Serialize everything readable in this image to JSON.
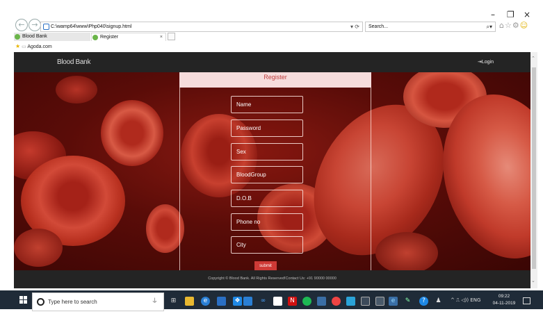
{
  "browser": {
    "address": "C:\\wamp64\\www\\Php040\\signup.html",
    "address_controls": "▾ ⟳",
    "search_placeholder": "Search...",
    "search_controls": "⌕▾",
    "tabs": [
      {
        "label": "Blood Bank"
      },
      {
        "label": "Register",
        "close": "×"
      }
    ],
    "favorites_item": "Agoda.com",
    "window_controls": {
      "minimize": "–",
      "restore": "❐",
      "close": "×"
    }
  },
  "page": {
    "brand": "Blood Bank",
    "login": "⇥Login",
    "form_title": "Register",
    "fields": [
      {
        "placeholder": "Name"
      },
      {
        "placeholder": "Password"
      },
      {
        "placeholder": "Sex"
      },
      {
        "placeholder": "BloodGroup"
      },
      {
        "placeholder": "D.O.B"
      },
      {
        "placeholder": "Phone no"
      },
      {
        "placeholder": "City"
      }
    ],
    "submit": "submit",
    "footer": "Copyright © Blood Bank. All Rights Reserved!Contact Us: +91 90000 00000"
  },
  "taskbar": {
    "search_placeholder": "Type here to search",
    "tray_text": "^ ⎍ ◁)) ENG",
    "time": "09:22",
    "date": "04-11-2019"
  },
  "colors": {
    "navbar": "#242424",
    "accent_red": "#cf3a36",
    "register_bar": "#f6dcdc"
  }
}
